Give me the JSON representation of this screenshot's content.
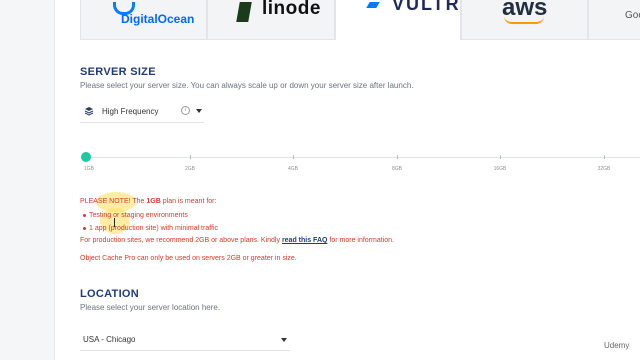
{
  "providers": [
    {
      "name": "DigitalOcean",
      "active": false
    },
    {
      "name": "linode",
      "active": false
    },
    {
      "name": "VULTR",
      "active": true
    },
    {
      "name": "aws",
      "active": false
    },
    {
      "name": "Google",
      "active": false
    }
  ],
  "server_size": {
    "title": "SERVER SIZE",
    "subtitle": "Please select your server size. You can always scale up or down your server size after launch.",
    "dropdown_value": "High Frequency",
    "info_glyph": "i",
    "slider_value": "1GB",
    "ticks": [
      "1GB",
      "2GB",
      "4GB",
      "8GB",
      "16GB",
      "32GB"
    ]
  },
  "notice": {
    "line1_prefix": "PLEASE NOTE! The ",
    "line1_bold": "1GB",
    "line1_suffix": " plan is meant for:",
    "bullet1": "Testing or staging environments",
    "bullet2": "1 app (production site) with minimal traffic",
    "line4_prefix": "For production sites, we recommend 2GB or above plans. Kindly ",
    "faq_link": "read this FAQ",
    "line4_suffix": " for more information.",
    "line5": "Object Cache Pro can only be used on servers 2GB or greater in size."
  },
  "location": {
    "title": "LOCATION",
    "subtitle": "Please select your server location here.",
    "selected": "USA - Chicago"
  },
  "watermark": "Udemy",
  "colors": {
    "accent": "#1ec8a0",
    "heading": "#1f3b7a",
    "warning": "#d83a2b"
  }
}
